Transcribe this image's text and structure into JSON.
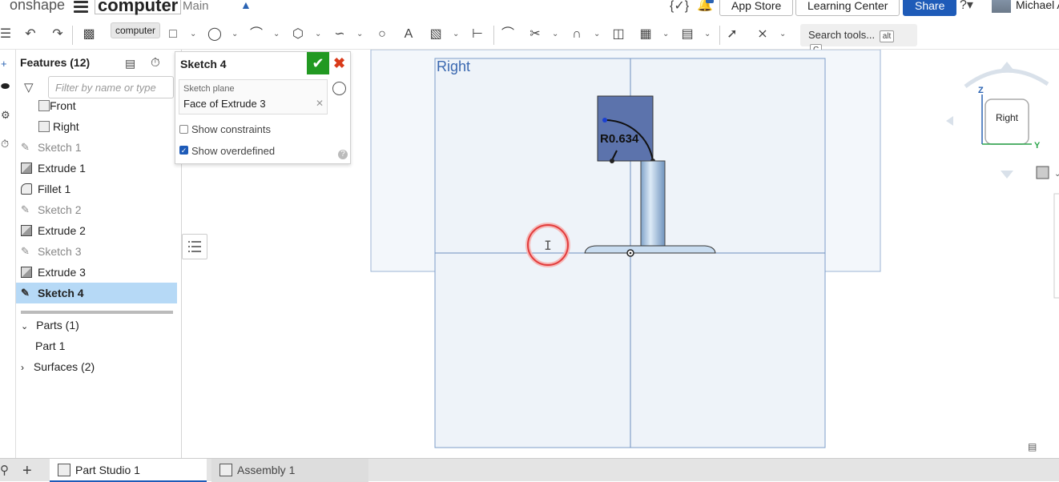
{
  "header": {
    "logo": "onshape",
    "doc_name": "computer",
    "branch": "Main",
    "app_store": "App Store",
    "learning_center": "Learning Center",
    "share": "Share",
    "user": "Michael A",
    "notification_count": "1"
  },
  "toolbar": {
    "tooltip": "computer",
    "search_label": "Search tools...",
    "search_kbd1": "alt",
    "search_kbd2": "C"
  },
  "features": {
    "title": "Features",
    "count": "(12)",
    "filter_placeholder": "Filter by name or type",
    "items": [
      {
        "label": "Front",
        "type": "plane",
        "state": "normal"
      },
      {
        "label": "Right",
        "type": "plane",
        "state": "normal"
      },
      {
        "label": "Sketch 1",
        "type": "sketch",
        "state": "dim"
      },
      {
        "label": "Extrude 1",
        "type": "extrude",
        "state": "normal"
      },
      {
        "label": "Fillet 1",
        "type": "fillet",
        "state": "normal"
      },
      {
        "label": "Sketch 2",
        "type": "sketch",
        "state": "dim"
      },
      {
        "label": "Extrude 2",
        "type": "extrude",
        "state": "normal"
      },
      {
        "label": "Sketch 3",
        "type": "sketch",
        "state": "dim"
      },
      {
        "label": "Extrude 3",
        "type": "extrude",
        "state": "normal"
      },
      {
        "label": "Sketch 4",
        "type": "sketch",
        "state": "selected"
      }
    ],
    "parts_label": "Parts (1)",
    "part1": "Part 1",
    "surfaces_label": "Surfaces (2)"
  },
  "dialog": {
    "title": "Sketch 4",
    "plane_label": "Sketch plane",
    "plane_value": "Face of Extrude 3",
    "show_constraints": "Show constraints",
    "show_constraints_checked": false,
    "show_overdefined": "Show overdefined",
    "show_overdefined_checked": true
  },
  "viewport": {
    "view_label": "Right",
    "dimension": "R0.634",
    "cube_label": "Right",
    "axis_z": "Z",
    "axis_y": "Y"
  },
  "tabs": [
    {
      "label": "Part Studio 1",
      "active": true
    },
    {
      "label": "Assembly 1",
      "active": false
    }
  ]
}
